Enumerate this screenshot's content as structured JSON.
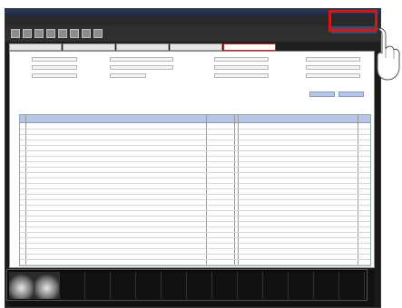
{
  "window": {
    "title": ""
  },
  "menubar": {
    "items": [
      "",
      "",
      "",
      "",
      "",
      ""
    ]
  },
  "toolbar": {
    "buttons": [
      "btn1",
      "btn2",
      "btn3",
      "btn4",
      "btn5",
      "btn6",
      "btn7",
      "btn8"
    ]
  },
  "window_controls": {
    "label": ""
  },
  "tabs": [
    {
      "label": ""
    },
    {
      "label": ""
    },
    {
      "label": ""
    },
    {
      "label": ""
    },
    {
      "label": "",
      "active": true
    }
  ],
  "form": {
    "fields": [
      {
        "label": "",
        "value": ""
      },
      {
        "label": "",
        "value": ""
      },
      {
        "label": "",
        "value": ""
      },
      {
        "label": "",
        "value": ""
      },
      {
        "label": "",
        "value": ""
      },
      {
        "label": "",
        "value": ""
      },
      {
        "label": "",
        "value": ""
      },
      {
        "label": "",
        "value": ""
      }
    ],
    "buttons": [
      "",
      ""
    ]
  },
  "grid": {
    "columns": [
      "",
      "",
      "",
      "",
      "",
      "",
      ""
    ],
    "row_count": 26
  },
  "thumbnails": {
    "count": 14
  },
  "colors": {
    "highlight": "#d01818",
    "header": "#b8c6e6",
    "titlebar": "#1d2740"
  }
}
